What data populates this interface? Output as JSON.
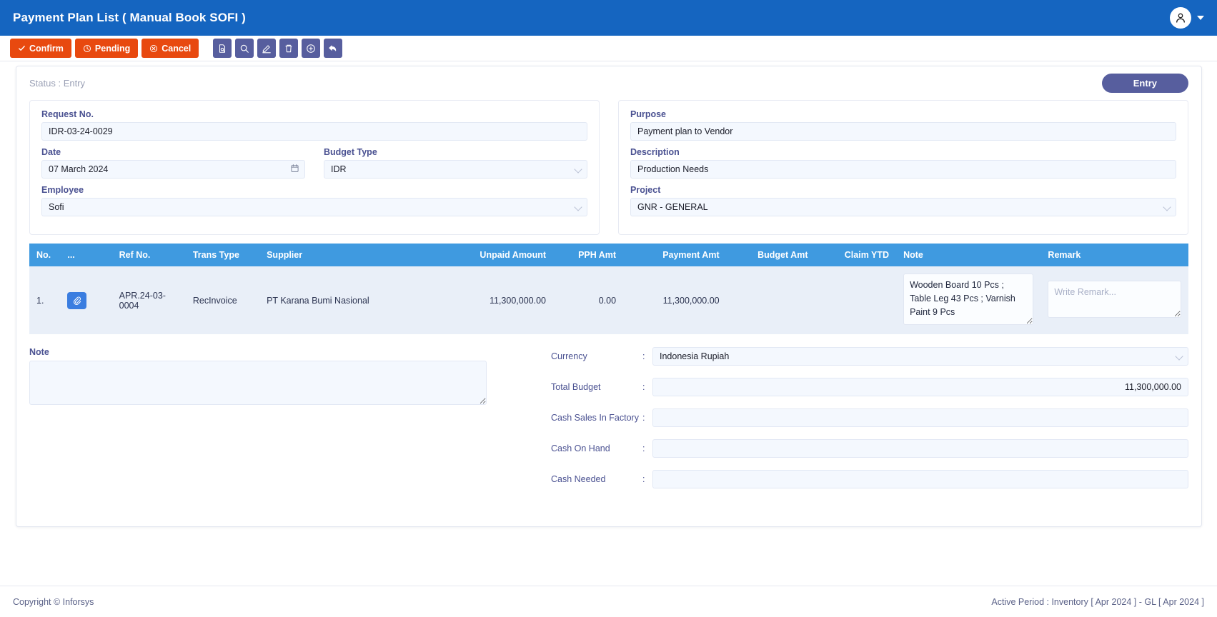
{
  "topbar": {
    "title": "Payment Plan List ( Manual Book SOFI )",
    "avatar_icon": "user-avatar-icon",
    "caret_icon": "chevron-down-icon"
  },
  "toolbar": {
    "confirm_label": "Confirm",
    "pending_label": "Pending",
    "cancel_label": "Cancel",
    "icons": [
      "document-search-icon",
      "search-icon",
      "edit-pencil-icon",
      "trash-icon",
      "add-circle-icon",
      "undo-arrow-icon"
    ]
  },
  "status": {
    "text": "Status : Entry",
    "entry_label": "Entry"
  },
  "form_left": {
    "request_no_label": "Request No.",
    "request_no_value": "IDR-03-24-0029",
    "date_label": "Date",
    "date_value": "07 March 2024",
    "budget_type_label": "Budget Type",
    "budget_type_value": "IDR",
    "employee_label": "Employee",
    "employee_value": "Sofi"
  },
  "form_right": {
    "purpose_label": "Purpose",
    "purpose_value": "Payment plan to Vendor",
    "description_label": "Description",
    "description_value": "Production Needs",
    "project_label": "Project",
    "project_value": "GNR - GENERAL"
  },
  "table": {
    "columns": [
      "No.",
      "...",
      "Ref No.",
      "Trans Type",
      "Supplier",
      "Unpaid Amount",
      "PPH Amt",
      "Payment Amt",
      "Budget Amt",
      "Claim YTD",
      "Note",
      "Remark"
    ],
    "rows": [
      {
        "no": "1.",
        "attach_icon": "paperclip-icon",
        "ref_no": "APR.24-03-0004",
        "trans_type": "RecInvoice",
        "supplier": "PT Karana Bumi Nasional",
        "unpaid_amount": "11,300,000.00",
        "pph_amt": "0.00",
        "payment_amt": "11,300,000.00",
        "budget_amt": "",
        "claim_ytd": "",
        "note": "Wooden Board 10 Pcs ; Table Leg 43 Pcs ; Varnish Paint 9 Pcs",
        "remark": "",
        "remark_placeholder": "Write Remark..."
      }
    ]
  },
  "bottom": {
    "note_label": "Note",
    "note_value": "",
    "summary": [
      {
        "label": "Currency",
        "value": "Indonesia Rupiah",
        "type": "select",
        "align": "left"
      },
      {
        "label": "Total Budget",
        "value": "11,300,000.00",
        "type": "input",
        "align": "right"
      },
      {
        "label": "Cash Sales In Factory",
        "value": "",
        "type": "input",
        "align": "right"
      },
      {
        "label": "Cash On Hand",
        "value": "",
        "type": "input",
        "align": "right"
      },
      {
        "label": "Cash Needed",
        "value": "",
        "type": "input",
        "align": "right"
      }
    ],
    "colon": ":"
  },
  "footer": {
    "copyright": "Copyright © Inforsys",
    "active_period": "Active Period  :  Inventory [ Apr 2024 ]  -  GL [ Apr 2024 ]"
  },
  "colors": {
    "topbar_blue": "#1565c0",
    "action_orange": "#e8490f",
    "icon_purple": "#575e9e",
    "table_header_blue": "#3f9ae0",
    "row_bg": "#e9eff8",
    "label_indigo": "#4a5191"
  }
}
